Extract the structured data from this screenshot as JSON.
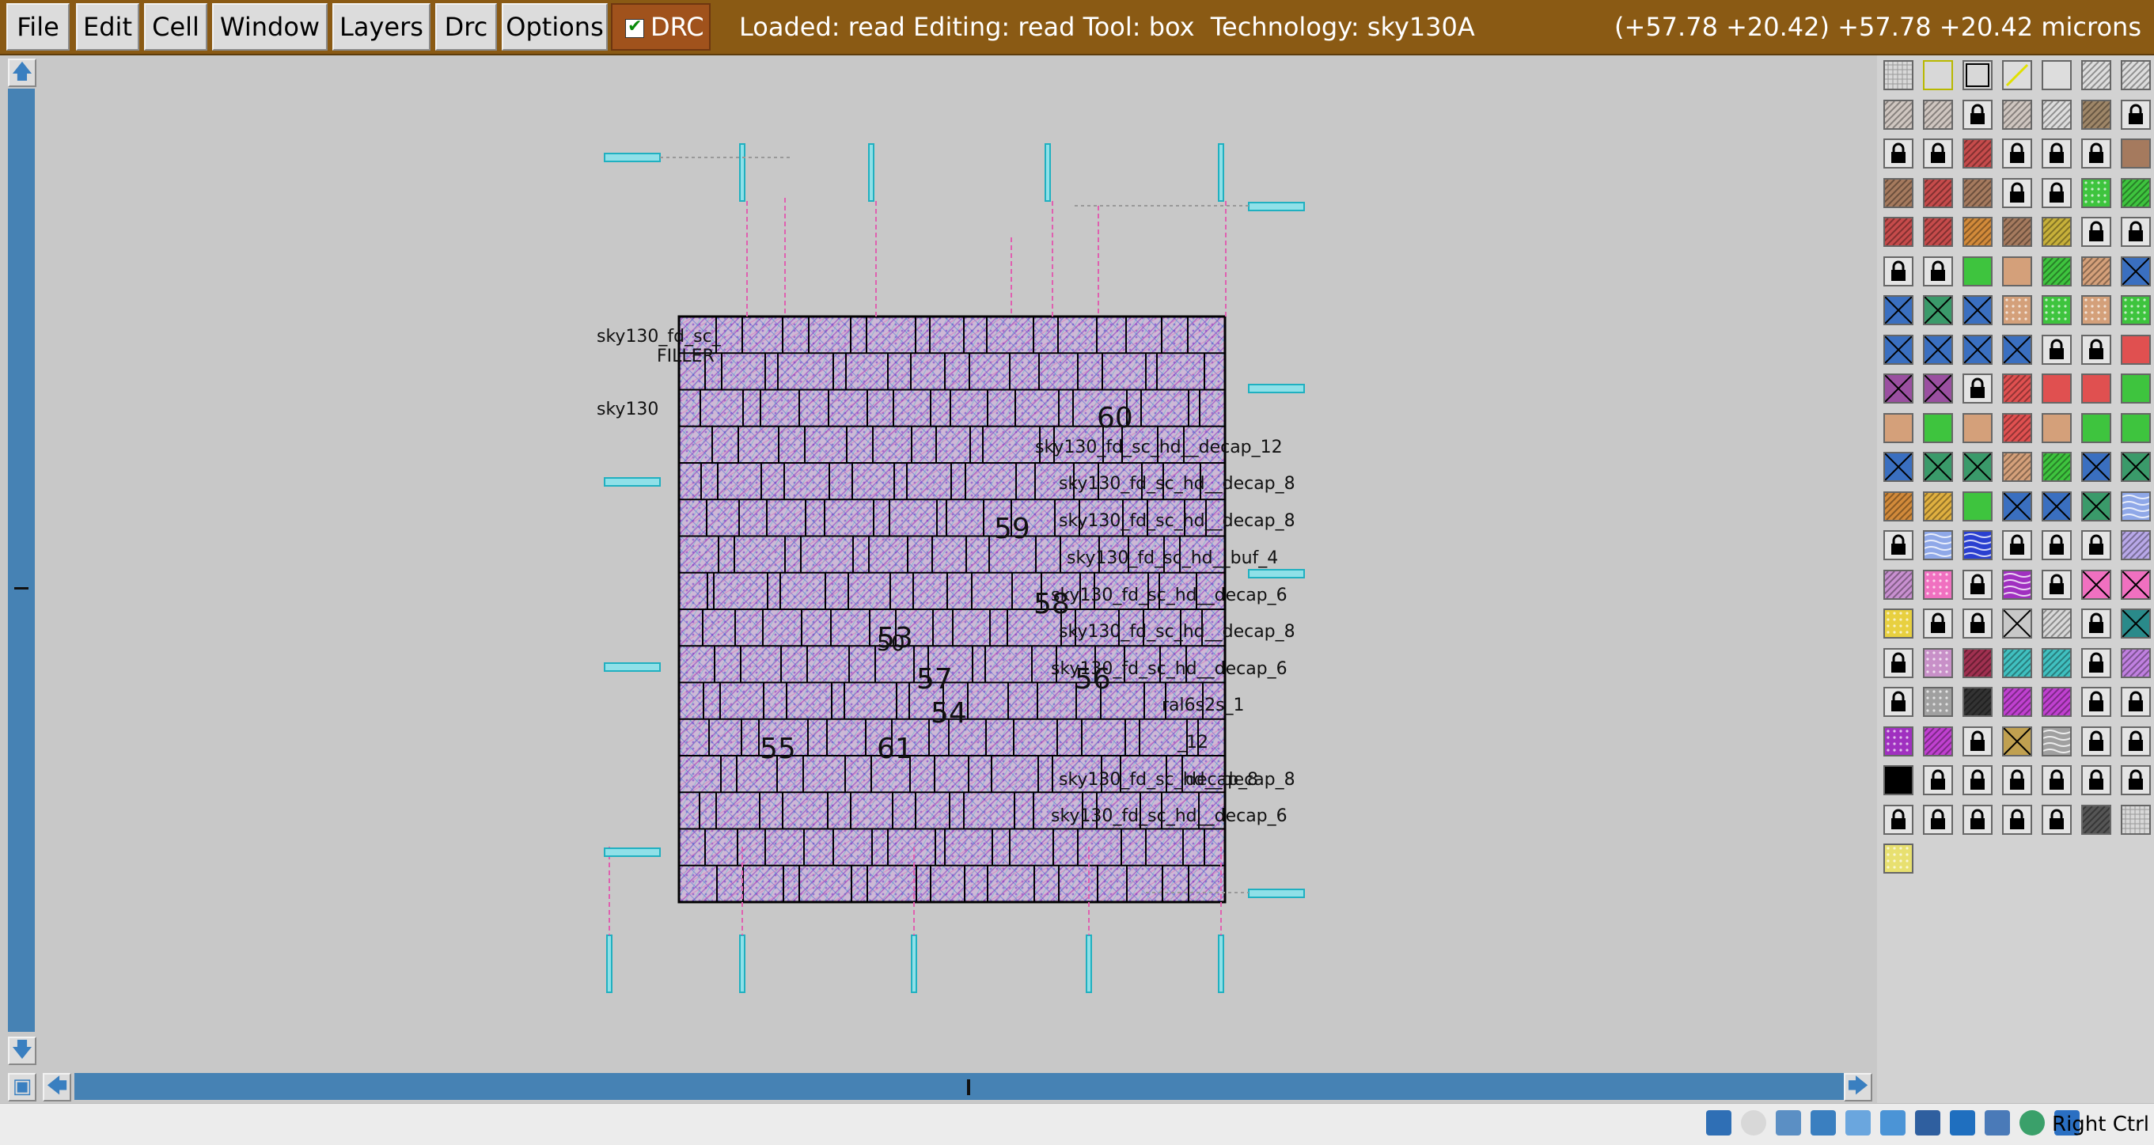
{
  "menubar": {
    "menus": [
      "File",
      "Edit",
      "Cell",
      "Window",
      "Layers",
      "Drc",
      "Options"
    ],
    "drc_label": "DRC",
    "drc_checked": true,
    "status": "Loaded: read Editing: read Tool: box  Technology: sky130A",
    "coordinates": "(+57.78 +20.42) +57.78 +20.42 microns",
    "bar_color": "#8a5a14"
  },
  "layout": {
    "cell_labels": [
      "sky130_fd_sc_",
      "sky130",
      "sky130_fd_sc_hd__decap_12",
      "sky130_fd_sc_hd__decap_8",
      "sky130_fd_sc_hd__decap_8",
      "sky130_fd_sc_hd__buf_4",
      "sky130_fd_sc_hd__decap_6",
      "sky130_fd_sc_hd__decap_8",
      "sky130_fd_sc_hd__decap_6",
      "sky130_fd_sc_hd__decap_8",
      "sky130_fd_sc_hd__decap_6",
      "ral6s2s_1",
      "_12",
      "decap_8"
    ],
    "filler_label": "FILLER",
    "numbers": [
      "60",
      "59",
      "58",
      "57",
      "56",
      "55",
      "54",
      "53",
      "61",
      "50",
      "55"
    ]
  },
  "palette": {
    "rows": 21,
    "columns": 7
  },
  "taskbar": {
    "host_key": "Right Ctrl"
  },
  "colors": {
    "scroll": "#4682b4",
    "canvas": "#c8c8c8",
    "metal1": "#9a6fd1",
    "poly": "#d64a8a",
    "diff": "#2e9a2e",
    "li": "#20b0c0"
  }
}
